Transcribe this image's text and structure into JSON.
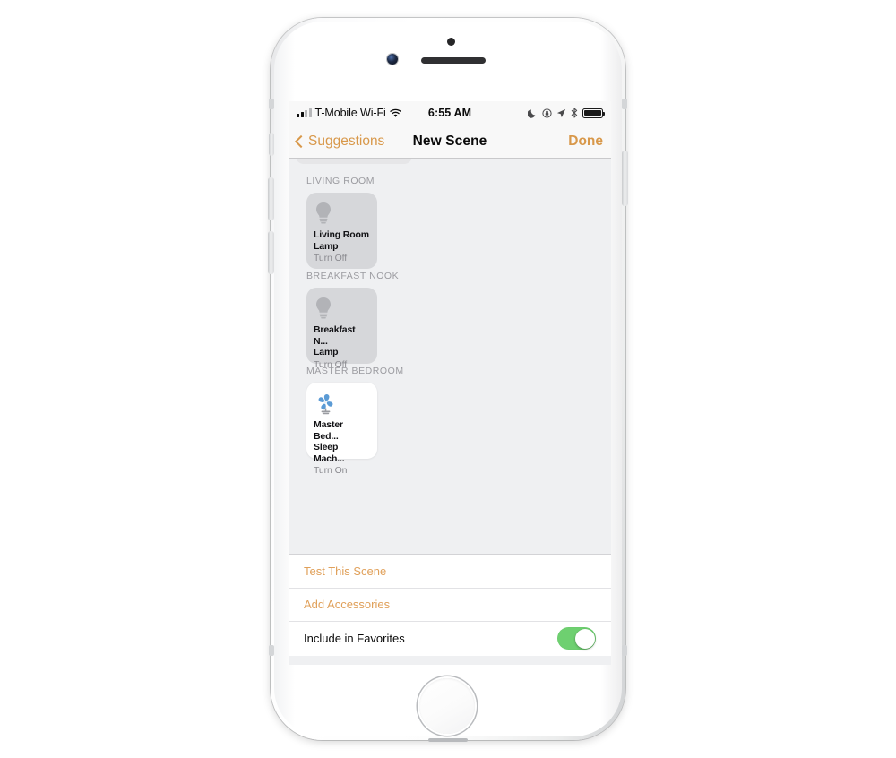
{
  "device": {
    "frame": "iphone-silver",
    "home_button": "home-button"
  },
  "status_bar": {
    "carrier": "T-Mobile Wi-Fi",
    "wifi_icon": "wifi-icon",
    "signal_icon": "signal-bars-icon",
    "time": "6:55 AM",
    "icons": [
      "moon-do-not-disturb-icon",
      "rotation-lock-icon",
      "location-arrow-icon",
      "bluetooth-icon",
      "battery-full-icon"
    ]
  },
  "nav": {
    "back_label": "Suggestions",
    "back_icon": "chevron-left-icon",
    "title": "New Scene",
    "done_label": "Done"
  },
  "groups": [
    {
      "title": "LIVING ROOM",
      "tiles": [
        {
          "name_line1": "Living Room",
          "name_line2": "Lamp",
          "state": "Turn Off",
          "icon": "lightbulb-icon",
          "active": false
        }
      ]
    },
    {
      "title": "BREAKFAST NOOK",
      "tiles": [
        {
          "name_line1": "Breakfast N...",
          "name_line2": "Lamp",
          "state": "Turn Off",
          "icon": "lightbulb-icon",
          "active": false
        }
      ]
    },
    {
      "title": "MASTER BEDROOM",
      "tiles": [
        {
          "name_line1": "Master Bed...",
          "name_line2": "Sleep Mach...",
          "state": "Turn On",
          "icon": "fan-icon",
          "active": true
        }
      ]
    }
  ],
  "actions": {
    "test_scene": "Test This Scene",
    "add_accessories": "Add Accessories",
    "include_favorites": "Include in Favorites",
    "favorites_toggle_state": "on"
  },
  "colors": {
    "accent": "#d8984a",
    "toggle_on": "#6ed070",
    "tile_inactive": "#d6d7da",
    "tile_active": "#ffffff",
    "screen_background": "#eff0f2",
    "fan_blue": "#5b9bd5"
  }
}
